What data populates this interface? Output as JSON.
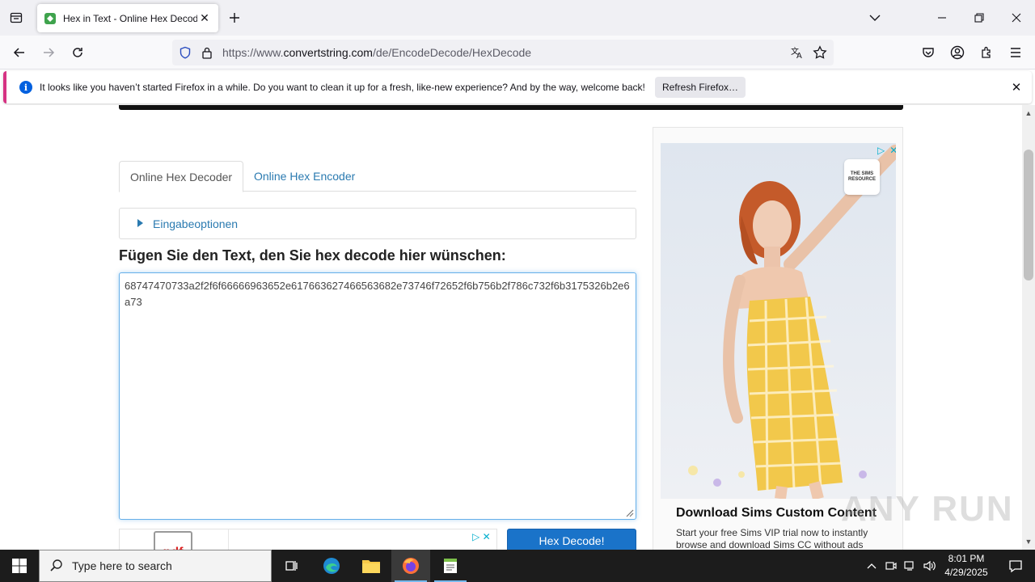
{
  "browser": {
    "tab_title": "Hex in Text - Online Hex Decod",
    "url_prefix": "https://www.",
    "url_host": "convertstring.com",
    "url_path": "/de/EncodeDecode/HexDecode"
  },
  "notification": {
    "message": "It looks like you haven’t started Firefox in a while. Do you want to clean it up for a fresh, like-new experience? And by the way, welcome back!",
    "refresh_label": "Refresh Firefox…",
    "info_glyph": "i"
  },
  "page": {
    "tabs": [
      {
        "label": "Online Hex Decoder"
      },
      {
        "label": "Online Hex Encoder"
      }
    ],
    "options_label": "Eingabeoptionen",
    "input_heading": "Fügen Sie den Text, den Sie hex decode hier wünschen:",
    "input_value": "68747470733a2f2f6f66666963652e617663627466563682e73746f72652f6b756b2f786c732f6b3175326b2e6a73",
    "decode_button": "Hex Decode!",
    "small_ad_thumb": "pdf"
  },
  "ad": {
    "logo_text": "THE SIMS RESOURCE",
    "title": "Download Sims Custom Content",
    "body": "Start your free Sims VIP trial now to instantly browse and download Sims CC without ads"
  },
  "watermark": "ANY RUN",
  "taskbar": {
    "search_placeholder": "Type here to search",
    "time": "8:01 PM",
    "date": "4/29/2025"
  },
  "colors": {
    "link": "#2a7ab0",
    "button": "#1a73c9",
    "notification_accent": "#d63383",
    "taskbar": "#1c1c1c"
  }
}
